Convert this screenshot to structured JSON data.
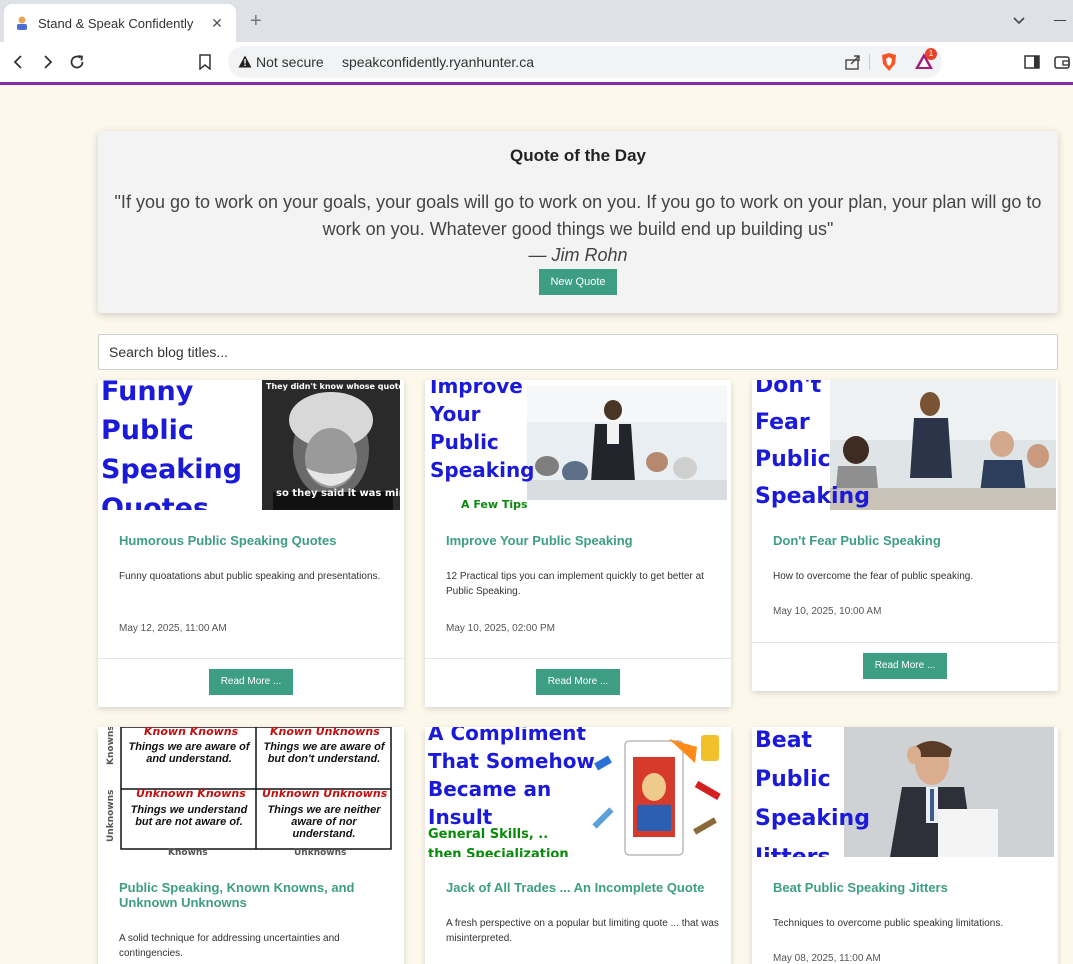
{
  "browser": {
    "tab_title": "Stand & Speak Confidently",
    "tab_close": "✕",
    "new_tab": "+",
    "security_label": "Not secure",
    "url": "speakconfidently.ryanhunter.ca",
    "rewards_count": "1"
  },
  "quote": {
    "heading": "Quote of the Day",
    "text": "\"If you go to work on your goals, your goals will go to work on you. If you go to work on your plan, your plan will go to work on you. Whatever good things we build end up building us\"",
    "author": "— Jim Rohn",
    "button_label": "New Quote"
  },
  "search": {
    "placeholder": "Search blog titles..."
  },
  "posts": [
    {
      "title": "Humorous Public Speaking Quotes",
      "description": "Funny quoatations abut public speaking and presentations.",
      "date": "May 12, 2025, 11:00 AM",
      "button": "Read More ...",
      "thumb_text": "Funny\nPublic\nSpeaking\nQuotes",
      "thumb_caption_top": "They didn't know whose quote it was.",
      "thumb_caption_bottom": "so they said it was mine."
    },
    {
      "title": "Improve Your Public Speaking",
      "description": "12 Practical tips you can implement quickly to get better at Public Speaking.",
      "date": "May 10, 2025, 02:00 PM",
      "button": "Read More ...",
      "thumb_text": "Improve\nYour\nPublic\nSpeaking",
      "thumb_sub": "A Few Tips"
    },
    {
      "title": "Don't Fear Public Speaking",
      "description": "How to overcome the fear of public speaking.",
      "date": "May 10, 2025, 10:00 AM",
      "button": "Read More ...",
      "thumb_text": "Don't\nFear\nPublic\nSpeaking"
    },
    {
      "title": "Public Speaking, Known Knowns, and Unknown Unknowns",
      "description": "A solid technique for addressing uncertainties and contingencies.",
      "date": "",
      "thumb_grid": {
        "side_top": "Knowns",
        "side_bottom": "Unknowns",
        "cells": [
          {
            "head": "Known Knowns",
            "body": "Things we are aware of and understand."
          },
          {
            "head": "Known Unknowns",
            "body": "Things we are aware of but don't understand."
          },
          {
            "head": "Unknown Knowns",
            "body": "Things we understand but are not aware of."
          },
          {
            "head": "Unknown Unknowns",
            "body": "Things we are neither aware of nor understand."
          }
        ],
        "bottom_left": "Knowns",
        "bottom_right": "Unknowns"
      }
    },
    {
      "title": "Jack of All Trades ... An Incomplete Quote",
      "description": "A fresh perspective on a popular but limiting quote ... that was misinterpreted.",
      "date": "",
      "thumb_text": "A Compliment\nThat Somehow\nBecame an\nInsult",
      "thumb_sub": "General Skills, ..\nthen Specialization"
    },
    {
      "title": "Beat Public Speaking Jitters",
      "description": "Techniques to overcome public speaking limitations.",
      "date": "May 08, 2025, 11:00 AM",
      "thumb_text": "Beat\nPublic\nSpeaking\nJitters"
    }
  ],
  "colors": {
    "accent": "#3d9e83",
    "page_bg": "#fcf8ec",
    "brand_line": "#8a2ca8",
    "thumb_blue": "#1a1ad8"
  }
}
